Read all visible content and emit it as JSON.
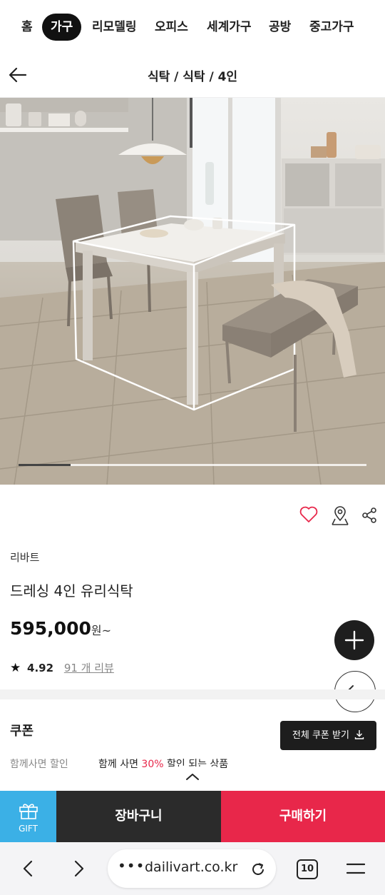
{
  "top_nav": {
    "items": [
      {
        "label": "홈",
        "active": false
      },
      {
        "label": "가구",
        "active": true
      },
      {
        "label": "리모델링",
        "active": false
      },
      {
        "label": "오피스",
        "active": false
      },
      {
        "label": "세계가구",
        "active": false
      },
      {
        "label": "공방",
        "active": false
      },
      {
        "label": "중고가구",
        "active": false
      }
    ]
  },
  "header": {
    "back_icon": "arrow-left-icon",
    "breadcrumb": "식탁 / 식탁 / 4인"
  },
  "gallery": {
    "image_progress": 0.15
  },
  "actions": {
    "wishlist_icon": "heart-icon",
    "location_icon": "map-pin-icon",
    "share_icon": "share-icon"
  },
  "product": {
    "brand": "리바트",
    "name": "드레싱 4인 유리식탁",
    "price": "595,000",
    "price_unit": "원~",
    "rating": "4.92",
    "review_link": "91 개 리뷰"
  },
  "coupon": {
    "title": "쿠폰",
    "download_all_button": "전체 쿠폰 받기",
    "bundle_label": "함께사면 할인",
    "bundle_text_before": "함께 사면 ",
    "bundle_percent": "30%",
    "bundle_text_after": " 할인 되는 상품"
  },
  "bottom_bar": {
    "gift_label": "GIFT",
    "cart_label": "장바구니",
    "buy_label": "구매하기"
  },
  "browser": {
    "url": "dailivart.co.kr",
    "tab_count": "10"
  },
  "colors": {
    "accent": "#e8274a",
    "gift": "#3bb0e6",
    "dark": "#2b2b2b"
  }
}
